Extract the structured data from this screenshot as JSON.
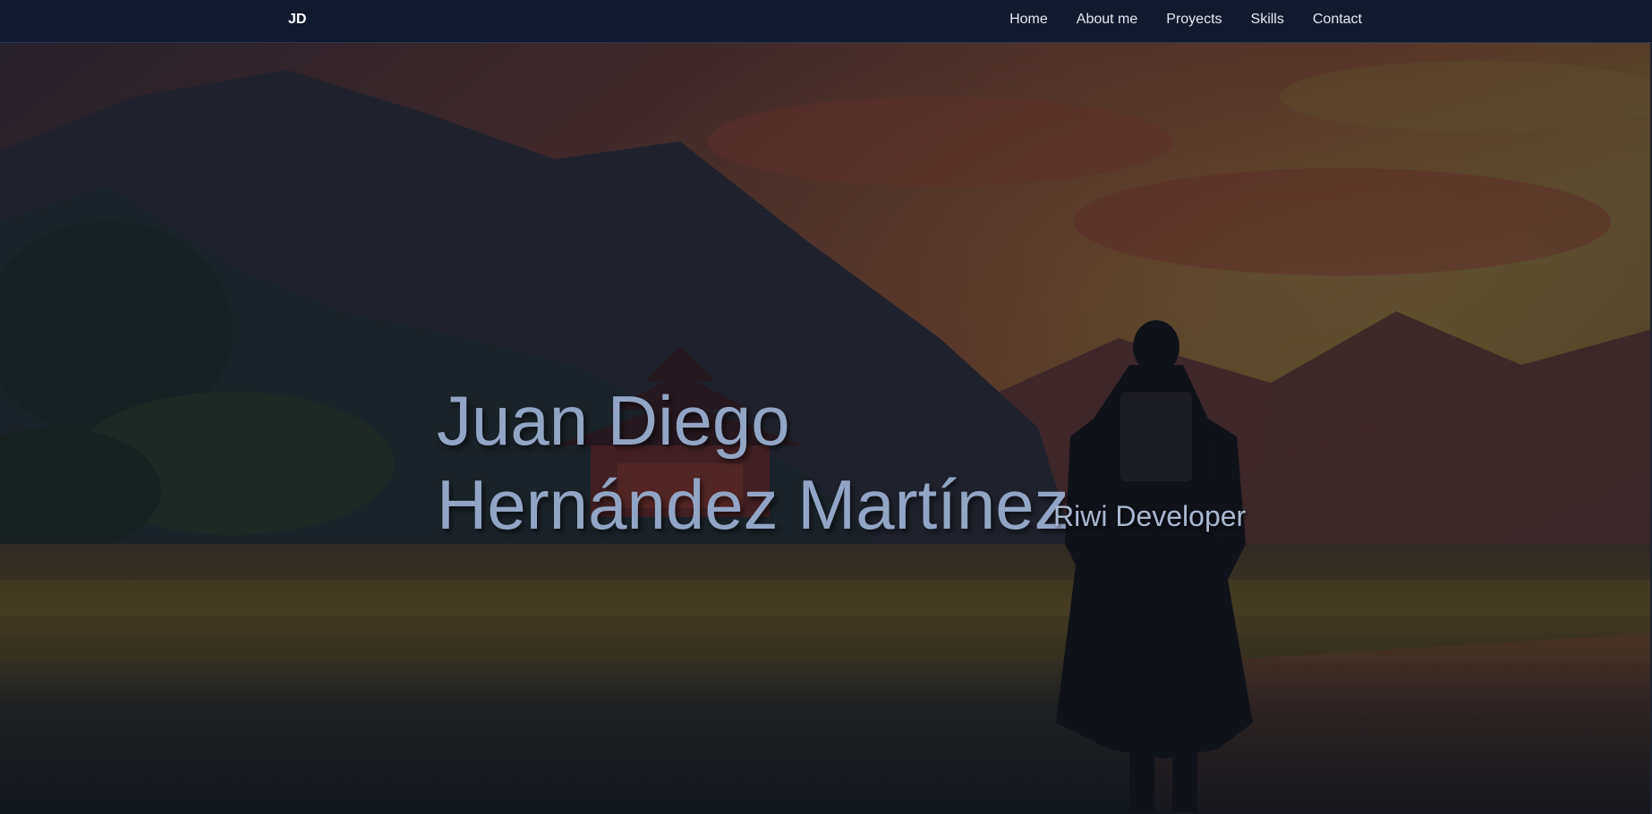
{
  "navbar": {
    "brand": "JD",
    "links": [
      {
        "label": "Home"
      },
      {
        "label": "About me"
      },
      {
        "label": "Proyects"
      },
      {
        "label": "Skills"
      },
      {
        "label": "Contact"
      }
    ]
  },
  "hero": {
    "name_line1": "Juan Diego",
    "name_line2": "Hernández Martínez",
    "role": "Riwi Developer",
    "background": "dark anime landscape: mountains, red temple, sunset sky, lone cloaked warrior walking"
  },
  "colors": {
    "navbar_bg": "#121a2e",
    "hero_text": "#93a5c4",
    "overlay": "#0f1729"
  }
}
